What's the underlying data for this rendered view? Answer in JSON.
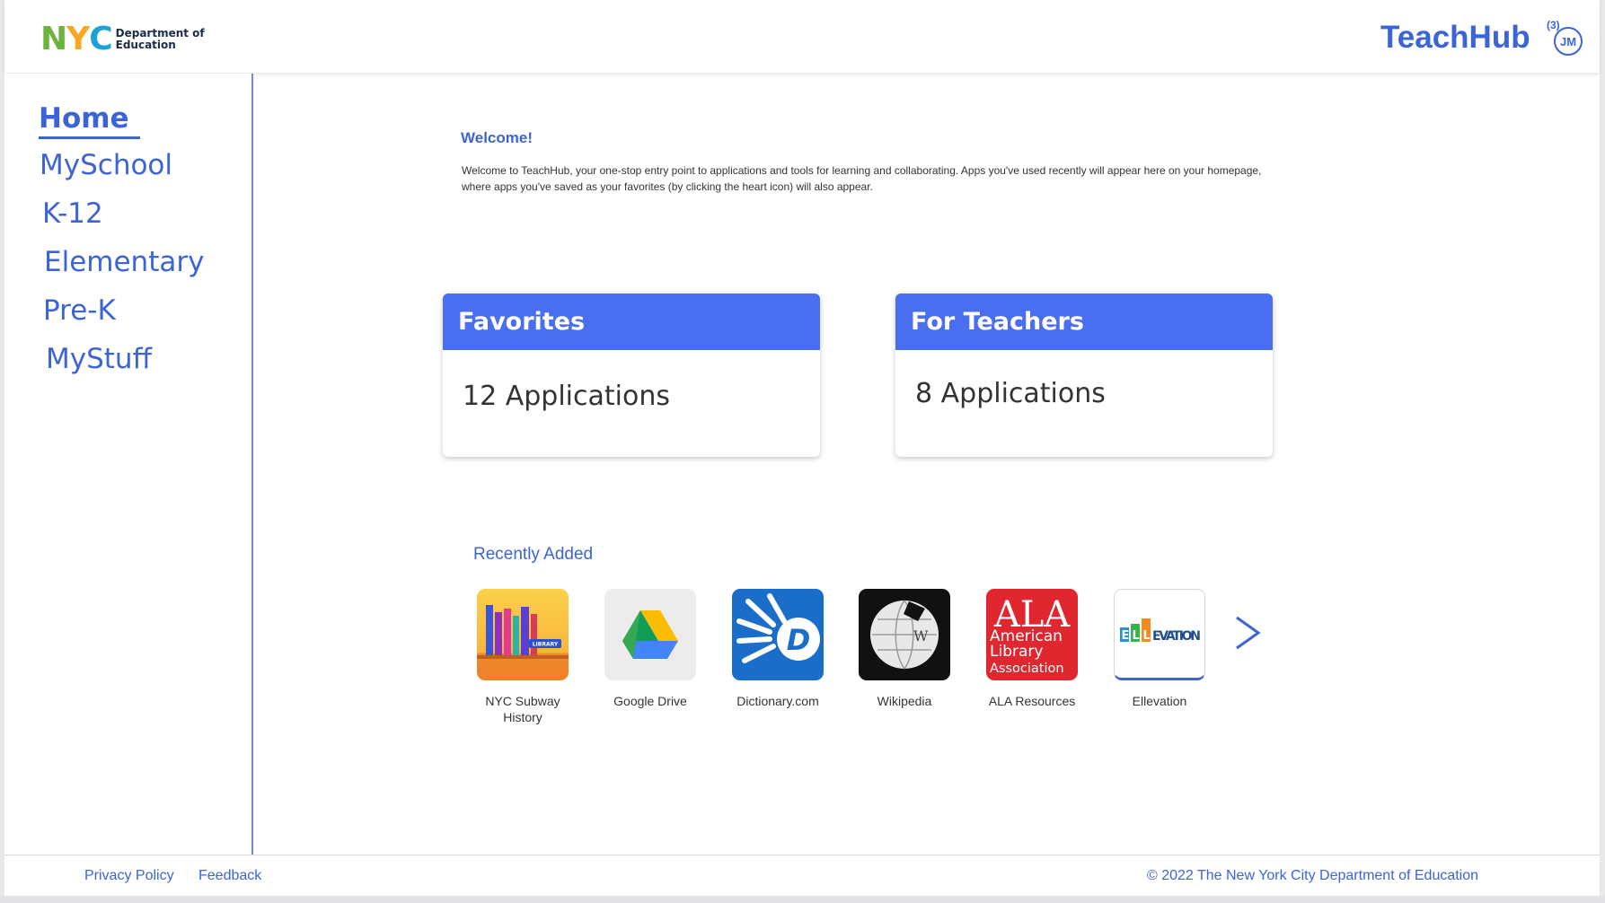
{
  "header": {
    "logo_letters": [
      "N",
      "Y",
      "C"
    ],
    "logo_line1": "Department of",
    "logo_line2": "Education",
    "brand": "TeachHub",
    "avatar_initials": "JM",
    "avatar_badge": "(3)"
  },
  "sidebar": {
    "items": [
      {
        "label": "Home",
        "active": true
      },
      {
        "label": "MySchool"
      },
      {
        "label": "K-12"
      },
      {
        "label": "Elementary"
      },
      {
        "label": "Pre-K"
      },
      {
        "label": "MyStuff"
      }
    ]
  },
  "welcome": {
    "title": "Welcome!",
    "text": "Welcome to TeachHub, your one-stop entry point to applications and tools for learning and collaborating. Apps you've used recently will appear here on your homepage, where apps you've saved as your favorites (by clicking the heart icon) will also appear."
  },
  "cards": [
    {
      "title": "Favorites",
      "body": "12 Applications"
    },
    {
      "title": "For Teachers",
      "body": "8 Applications"
    }
  ],
  "recent": {
    "title": "Recently Added",
    "apps": [
      {
        "label": "NYC Subway History",
        "icon": "library-books-icon",
        "icon_text": "LIBRARY"
      },
      {
        "label": "Google Drive",
        "icon": "google-drive-icon"
      },
      {
        "label": "Dictionary.com",
        "icon": "dictionary-icon",
        "icon_text": "D"
      },
      {
        "label": "Wikipedia",
        "icon": "wikipedia-globe-icon",
        "icon_text": "W"
      },
      {
        "label": "ALA Resources",
        "icon": "ala-icon",
        "icon_text_main": "ALA",
        "icon_text_lines": [
          "American",
          "Library",
          "Association"
        ]
      },
      {
        "label": "Ellevation",
        "icon": "ellevation-icon",
        "icon_text": "EVATION",
        "icon_letters": [
          "E",
          "L",
          "L"
        ]
      }
    ],
    "next_icon": "chevron-right-icon"
  },
  "footer": {
    "privacy": "Privacy Policy",
    "feedback": "Feedback",
    "copyright": "© 2022 The New York City Department of Education"
  },
  "colors": {
    "accent": "#3c64d6",
    "card_header": "#4a6ef0",
    "sidebar_border": "#6e8bd8"
  }
}
